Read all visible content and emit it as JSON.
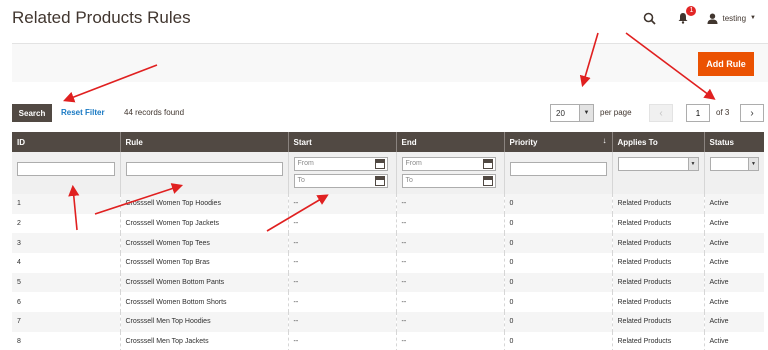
{
  "header": {
    "title": "Related Products Rules",
    "notification_count": "1",
    "username": "testing",
    "search_icon": "search-icon",
    "bell_icon": "bell-icon",
    "user_icon": "user-icon"
  },
  "actions": {
    "add_rule_label": "Add Rule",
    "accent_color": "#eb5202"
  },
  "toolbar": {
    "search_label": "Search",
    "reset_filter_label": "Reset Filter",
    "records_found": "44 records found",
    "per_page_value": "20",
    "per_page_label": "per page",
    "current_page": "1",
    "page_of": "of 3"
  },
  "grid": {
    "columns": [
      "ID",
      "Rule",
      "Start",
      "End",
      "Priority",
      "Applies To",
      "Status"
    ],
    "filters": {
      "from_placeholder": "From",
      "to_placeholder": "To"
    },
    "rows": [
      [
        "1",
        "Crosssell Women Top Hoodies",
        "--",
        "--",
        "0",
        "Related Products",
        "Active"
      ],
      [
        "2",
        "Crosssell Women Top Jackets",
        "--",
        "--",
        "0",
        "Related Products",
        "Active"
      ],
      [
        "3",
        "Crosssell Women Top Tees",
        "--",
        "--",
        "0",
        "Related Products",
        "Active"
      ],
      [
        "4",
        "Crosssell Women Top Bras",
        "--",
        "--",
        "0",
        "Related Products",
        "Active"
      ],
      [
        "5",
        "Crosssell Women Bottom Pants",
        "--",
        "--",
        "0",
        "Related Products",
        "Active"
      ],
      [
        "6",
        "Crosssell Women Bottom Shorts",
        "--",
        "--",
        "0",
        "Related Products",
        "Active"
      ],
      [
        "7",
        "Crosssell Men Top Hoodies",
        "--",
        "--",
        "0",
        "Related Products",
        "Active"
      ],
      [
        "8",
        "Crosssell Men Top Jackets",
        "--",
        "--",
        "0",
        "Related Products",
        "Active"
      ]
    ]
  },
  "annotation_color": "#e02020"
}
